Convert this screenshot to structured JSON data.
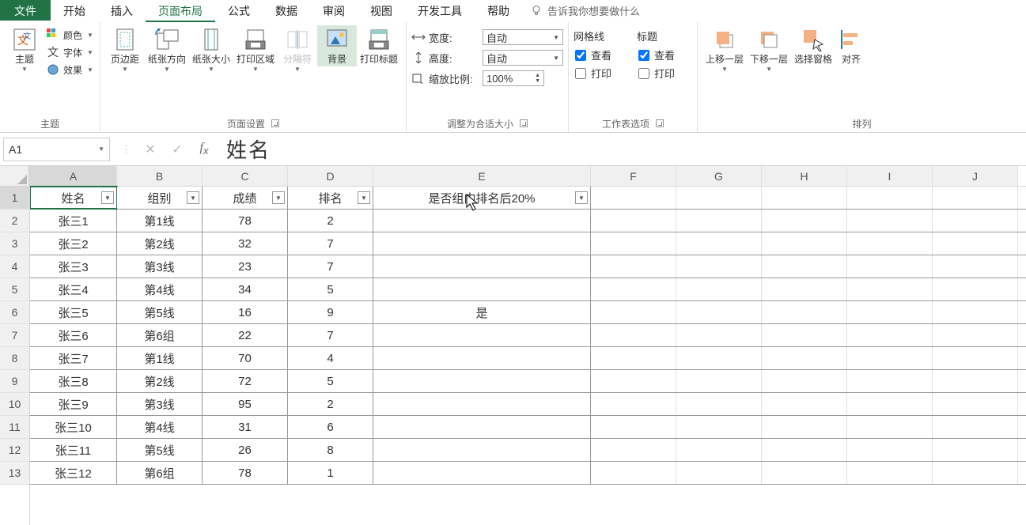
{
  "menu": {
    "file": "文件",
    "tabs": [
      "开始",
      "插入",
      "页面布局",
      "公式",
      "数据",
      "审阅",
      "视图",
      "开发工具",
      "帮助"
    ],
    "active_tab_index": 2,
    "tell_me": "告诉我你想要做什么"
  },
  "ribbon": {
    "themes": {
      "main_label": "主题",
      "colors": "颜色",
      "fonts": "字体",
      "effects": "效果",
      "group_label": "主题"
    },
    "page_setup": {
      "margins": "页边距",
      "orientation": "纸张方向",
      "size": "纸张大小",
      "print_area": "打印区域",
      "breaks": "分隔符",
      "background": "背景",
      "print_titles": "打印标题",
      "group_label": "页面设置"
    },
    "scale": {
      "width_label": "宽度:",
      "width_value": "自动",
      "height_label": "高度:",
      "height_value": "自动",
      "scale_label": "缩放比例:",
      "scale_value": "100%",
      "group_label": "调整为合适大小"
    },
    "sheet_opts": {
      "gridlines_hdr": "网格线",
      "headings_hdr": "标题",
      "view": "查看",
      "print": "打印",
      "gridlines_view_checked": true,
      "gridlines_print_checked": false,
      "headings_view_checked": true,
      "headings_print_checked": false,
      "group_label": "工作表选项"
    },
    "arrange": {
      "bring_fwd": "上移一层",
      "send_back": "下移一层",
      "selection_pane": "选择窗格",
      "align": "对齐",
      "group_label": "排列"
    }
  },
  "namebox": {
    "ref": "A1"
  },
  "formula": {
    "value": "姓名"
  },
  "columns": {
    "letters": [
      "A",
      "B",
      "C",
      "D",
      "E",
      "F",
      "G",
      "H",
      "I",
      "J"
    ],
    "widths": [
      110,
      108,
      108,
      108,
      275,
      108,
      108,
      108,
      108,
      108
    ],
    "active_index": 0
  },
  "rows": {
    "count": 13,
    "active_index": 0
  },
  "chart_data": {
    "type": "table",
    "headers": [
      "姓名",
      "组别",
      "成绩",
      "排名",
      "是否组内排名后20%"
    ],
    "rows": [
      [
        "张三1",
        "第1线",
        "78",
        "2",
        ""
      ],
      [
        "张三2",
        "第2线",
        "32",
        "7",
        ""
      ],
      [
        "张三3",
        "第3线",
        "23",
        "7",
        ""
      ],
      [
        "张三4",
        "第4线",
        "34",
        "5",
        ""
      ],
      [
        "张三5",
        "第5线",
        "16",
        "9",
        "是"
      ],
      [
        "张三6",
        "第6组",
        "22",
        "7",
        ""
      ],
      [
        "张三7",
        "第1线",
        "70",
        "4",
        ""
      ],
      [
        "张三8",
        "第2线",
        "72",
        "5",
        ""
      ],
      [
        "张三9",
        "第3线",
        "95",
        "2",
        ""
      ],
      [
        "张三10",
        "第4线",
        "31",
        "6",
        ""
      ],
      [
        "张三11",
        "第5线",
        "26",
        "8",
        ""
      ],
      [
        "张三12",
        "第6组",
        "78",
        "1",
        ""
      ]
    ]
  }
}
